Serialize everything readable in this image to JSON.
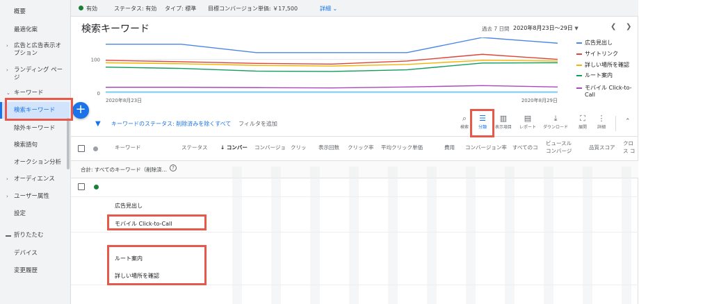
{
  "sidebar": {
    "items": [
      {
        "label": "概要"
      },
      {
        "label": "最適化案"
      },
      {
        "label": "広告と広告表示オプション"
      },
      {
        "label": "ランディング ページ"
      },
      {
        "label": "キーワード"
      },
      {
        "label": "検索キーワード"
      },
      {
        "label": "除外キーワード"
      },
      {
        "label": "検索語句"
      },
      {
        "label": "オークション分析"
      },
      {
        "label": "オーディエンス"
      },
      {
        "label": "ユーザー属性"
      },
      {
        "label": "設定"
      },
      {
        "label": "折りたたむ"
      },
      {
        "label": "デバイス"
      },
      {
        "label": "変更履歴"
      }
    ]
  },
  "status_bar": {
    "status": "有効",
    "status_label": "ステータス: 有効",
    "type_label": "タイプ: 標準",
    "target_cpa": "目標コンバージョン単価: ￥17,500",
    "details_link": "詳細"
  },
  "header": {
    "title": "検索キーワード",
    "range_label": "過去 7 日間",
    "range_value": "2020年8月23日～29日"
  },
  "chart_data": {
    "type": "line",
    "x_tick_labels": [
      "2020年8月23日",
      "2020年8月29日"
    ],
    "y_tick_labels": [
      "100",
      "0"
    ],
    "ylim": [
      0,
      165
    ],
    "x_points": 7,
    "series": [
      {
        "name": "広告見出し",
        "color": "#4a86e8",
        "values": [
          145,
          145,
          120,
          120,
          120,
          165,
          148
        ]
      },
      {
        "name": "サイトリンク",
        "color": "#db4437",
        "values": [
          97,
          93,
          88,
          86,
          95,
          115,
          100
        ]
      },
      {
        "name": "詳しい場所を確認",
        "color": "#f4b400",
        "values": [
          90,
          87,
          82,
          80,
          85,
          97,
          95
        ]
      },
      {
        "name": "ルート案内",
        "color": "#0f9d58",
        "values": [
          77,
          73,
          65,
          64,
          69,
          89,
          90
        ]
      },
      {
        "name": "モバイル Click-to-Call",
        "color": "#ab47bc",
        "values": [
          17,
          17,
          16,
          15,
          18,
          22,
          18
        ]
      },
      {
        "name": "",
        "color": "#4fc3f7",
        "values": [
          3,
          3,
          3,
          3,
          3,
          3,
          3
        ]
      }
    ],
    "legend_position": "right"
  },
  "filter": {
    "text": "キーワードのステータス: 削除済みを除くすべて",
    "add": "フィルタを追加"
  },
  "tools": [
    {
      "label": "検索",
      "icon": "search-icon"
    },
    {
      "label": "分類",
      "icon": "segment-icon"
    },
    {
      "label": "表示項目",
      "icon": "columns-icon"
    },
    {
      "label": "レポート",
      "icon": "reports-icon"
    },
    {
      "label": "ダウンロード",
      "icon": "download-icon"
    },
    {
      "label": "展開",
      "icon": "expand-icon"
    },
    {
      "label": "詳細",
      "icon": "more-icon"
    }
  ],
  "table": {
    "columns": [
      "キーワード",
      "ステータス",
      "コンバー",
      "コンバージョ",
      "クリッ",
      "表示回数",
      "クリック率",
      "平均クリック単価",
      "費用",
      "コンバージョン率",
      "すべてのコ",
      "ビュースル コンバージ",
      "品質スコア",
      "クロス コンバ"
    ],
    "total_label": "合計: すべてのキーワード（削除済…",
    "segment_rows": [
      "広告見出し",
      "モバイル Click-to-Call",
      "ルート案内",
      "詳しい場所を確認"
    ]
  }
}
